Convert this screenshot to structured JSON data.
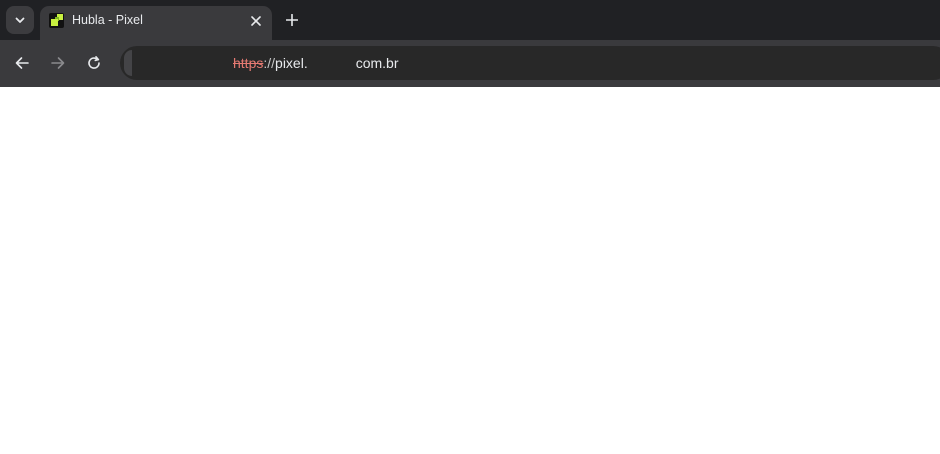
{
  "browser": {
    "tab": {
      "title": "Hubla - Pixel",
      "favicon": "hubla-favicon-icon"
    },
    "toolbar": {
      "url_scheme": "https",
      "url_separator": "://",
      "url_host_prefix": "pixel.",
      "url_host_suffix": "com.br"
    },
    "icons": {
      "tab_search": "chevron-down-icon",
      "close": "close-icon",
      "new_tab": "plus-icon",
      "back": "arrow-left-icon",
      "forward": "arrow-right-icon",
      "reload": "reload-icon"
    },
    "colors": {
      "chrome_bg": "#202124",
      "toolbar_bg": "#3a3a3d",
      "omnibox_bg": "#282828",
      "insecure_scheme": "#e57a72",
      "favicon_accent": "#c8f040",
      "page_bg": "#ffffff"
    }
  }
}
